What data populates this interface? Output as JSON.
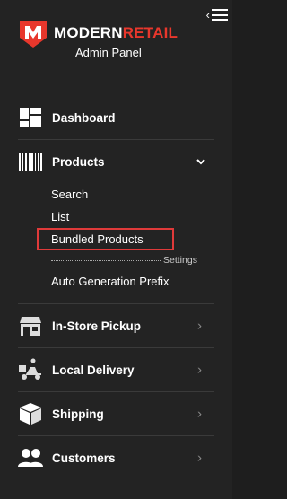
{
  "header": {
    "brand_part1": "MODERN",
    "brand_part2": "RETAIL",
    "subtitle": "Admin Panel"
  },
  "nav": {
    "dashboard": "Dashboard",
    "products": "Products",
    "products_sub": {
      "search": "Search",
      "list": "List",
      "bundled": "Bundled Products",
      "settings": "Settings",
      "auto_prefix": "Auto Generation Prefix"
    },
    "in_store_pickup": "In-Store Pickup",
    "local_delivery": "Local Delivery",
    "shipping": "Shipping",
    "customers": "Customers"
  },
  "colors": {
    "background": "#232323",
    "accent": "#e8372c",
    "active_border": "#e03a3a"
  }
}
